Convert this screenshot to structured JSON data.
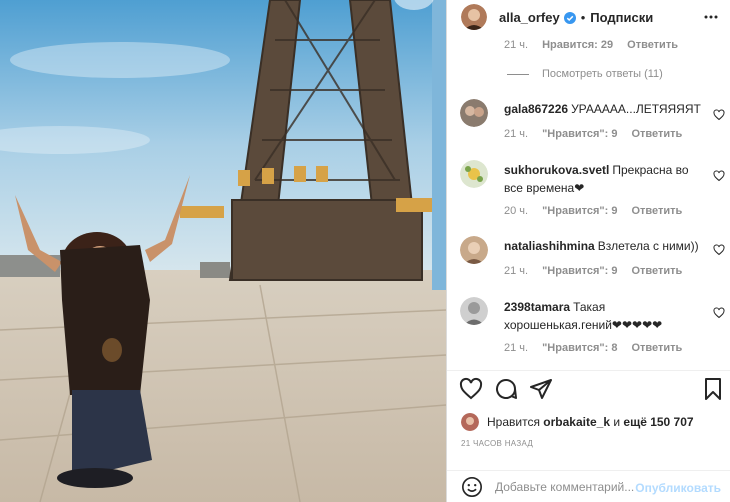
{
  "post": {
    "username": "alla_orfey",
    "verified_icon": "verified-badge-icon",
    "follow_label": "Подписки",
    "dot": "•",
    "more_icon": "more-options-icon"
  },
  "top_meta": {
    "time": "21 ч.",
    "likes": "Нравится: 29",
    "reply": "Ответить"
  },
  "view_replies": "Посмотреть ответы (11)",
  "comments": [
    {
      "user": "gala867226",
      "text": "УРААААА...ЛЕТЯЯЯЯТ",
      "time": "21 ч.",
      "likes": "\"Нравится\": 9",
      "reply": "Ответить"
    },
    {
      "user": "sukhorukova.svetl",
      "text": "Прекрасна во все времена❤",
      "time": "20 ч.",
      "likes": "\"Нравится\": 9",
      "reply": "Ответить"
    },
    {
      "user": "nataliashihmina",
      "text": "Взлетела с ними))",
      "time": "21 ч.",
      "likes": "\"Нравится\": 9",
      "reply": "Ответить"
    },
    {
      "user": "2398tamara",
      "text": "Такая хорошенькая.гений❤❤❤❤❤",
      "time": "21 ч.",
      "likes": "\"Нравится\": 8",
      "reply": "Ответить"
    }
  ],
  "likes": {
    "prefix": "Нравится",
    "user": "orbakaite_k",
    "middle": "и",
    "rest": "ещё 150 707"
  },
  "time_ago": "21 ЧАСОВ НАЗАД",
  "add_comment": {
    "placeholder": "Добавьте комментарий...",
    "publish": "Опубликовать"
  },
  "colors": {
    "link_blue": "#0095f6",
    "publish_disabled": "#b3dbff",
    "muted": "#8e8e8e",
    "text": "#262626",
    "border": "#dbdbdb"
  }
}
